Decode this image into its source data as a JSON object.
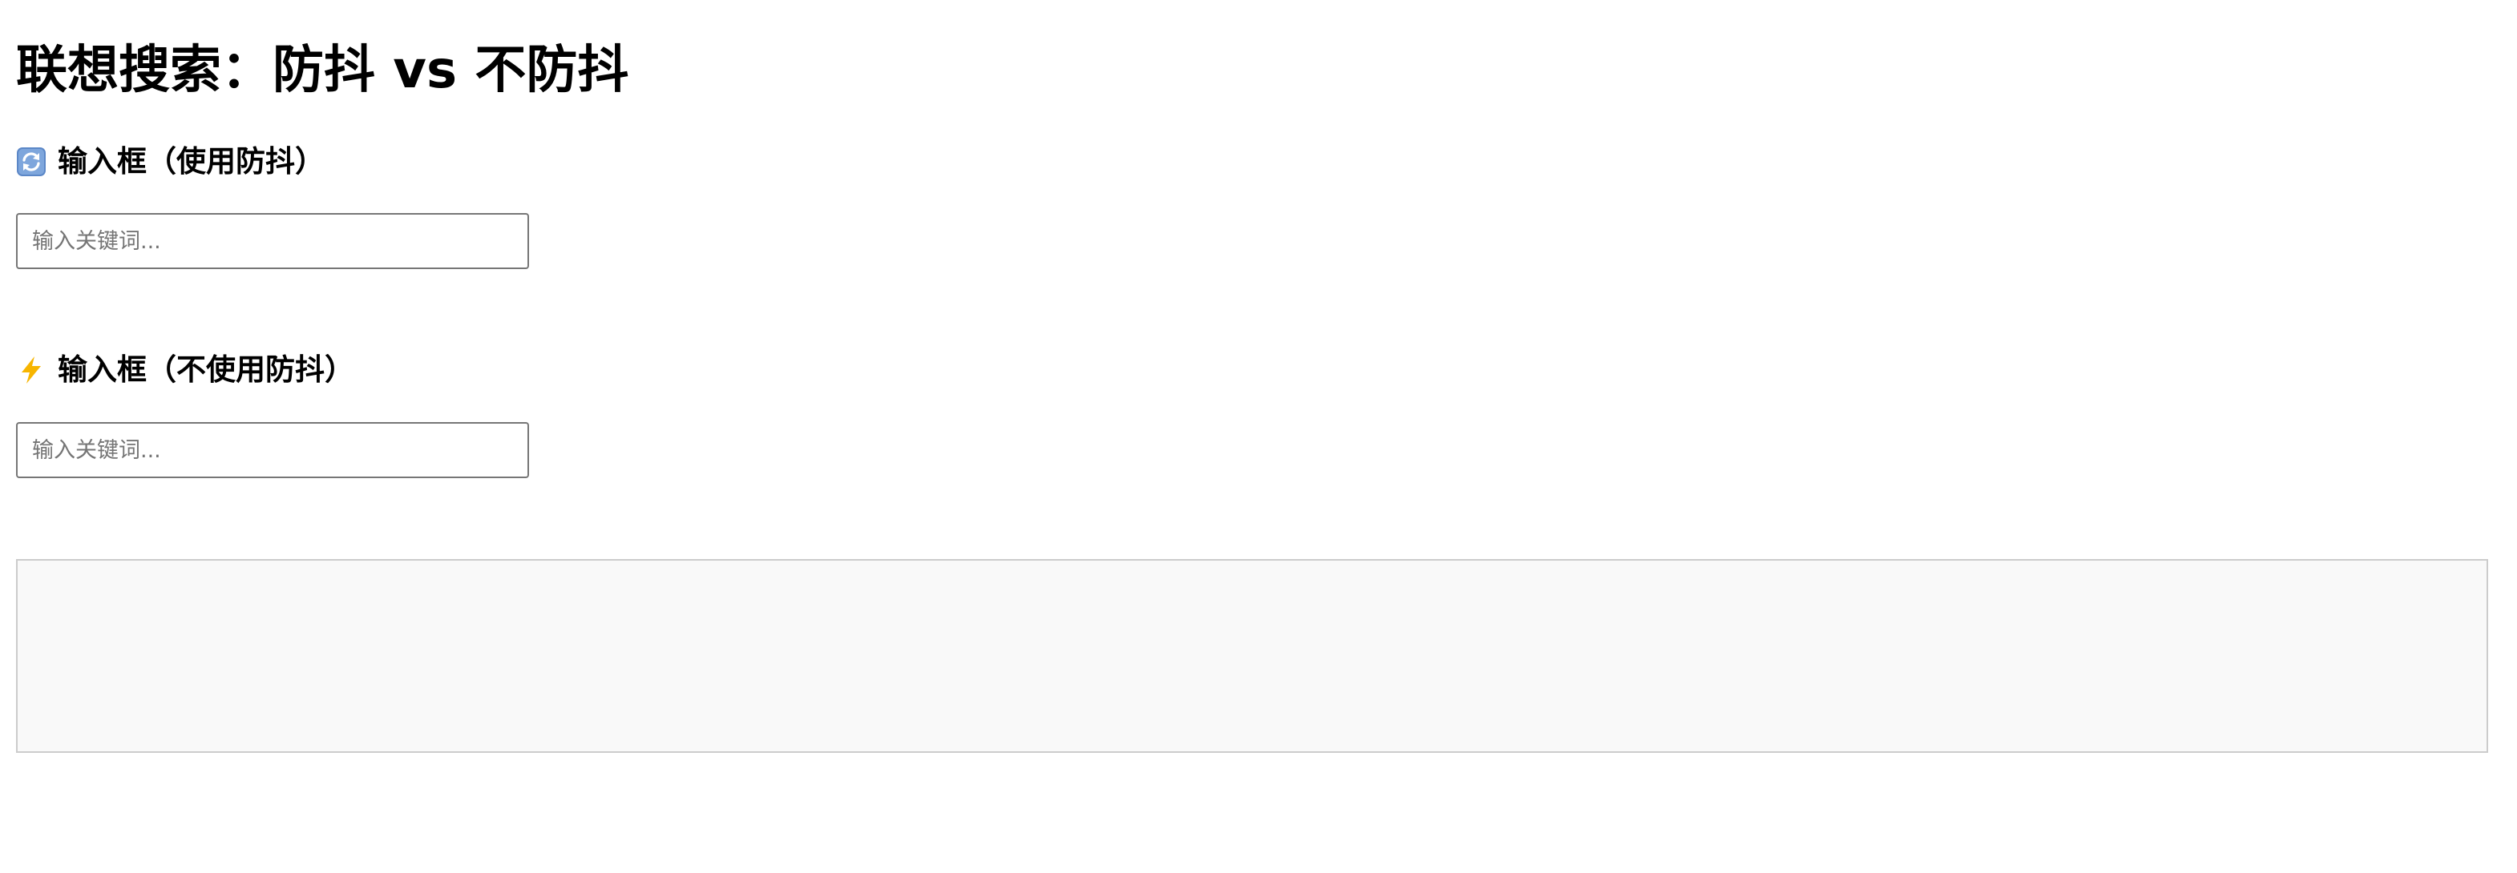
{
  "page": {
    "title": "联想搜索：防抖 vs 不防抖"
  },
  "sections": [
    {
      "icon": "counterclockwise-arrows-icon",
      "heading": "输入框（使用防抖）",
      "input": {
        "value": "",
        "placeholder": "输入关键词..."
      }
    },
    {
      "icon": "lightning-bolt-icon",
      "heading": "输入框（不使用防抖）",
      "input": {
        "value": "",
        "placeholder": "输入关键词..."
      }
    }
  ],
  "results": {
    "items": []
  },
  "colors": {
    "refresh_icon_bg": "#5b87c7",
    "lightning_icon": "#f7b500",
    "results_bg": "#f9f9f9",
    "results_border": "#cccccc",
    "input_border": "#767676"
  }
}
